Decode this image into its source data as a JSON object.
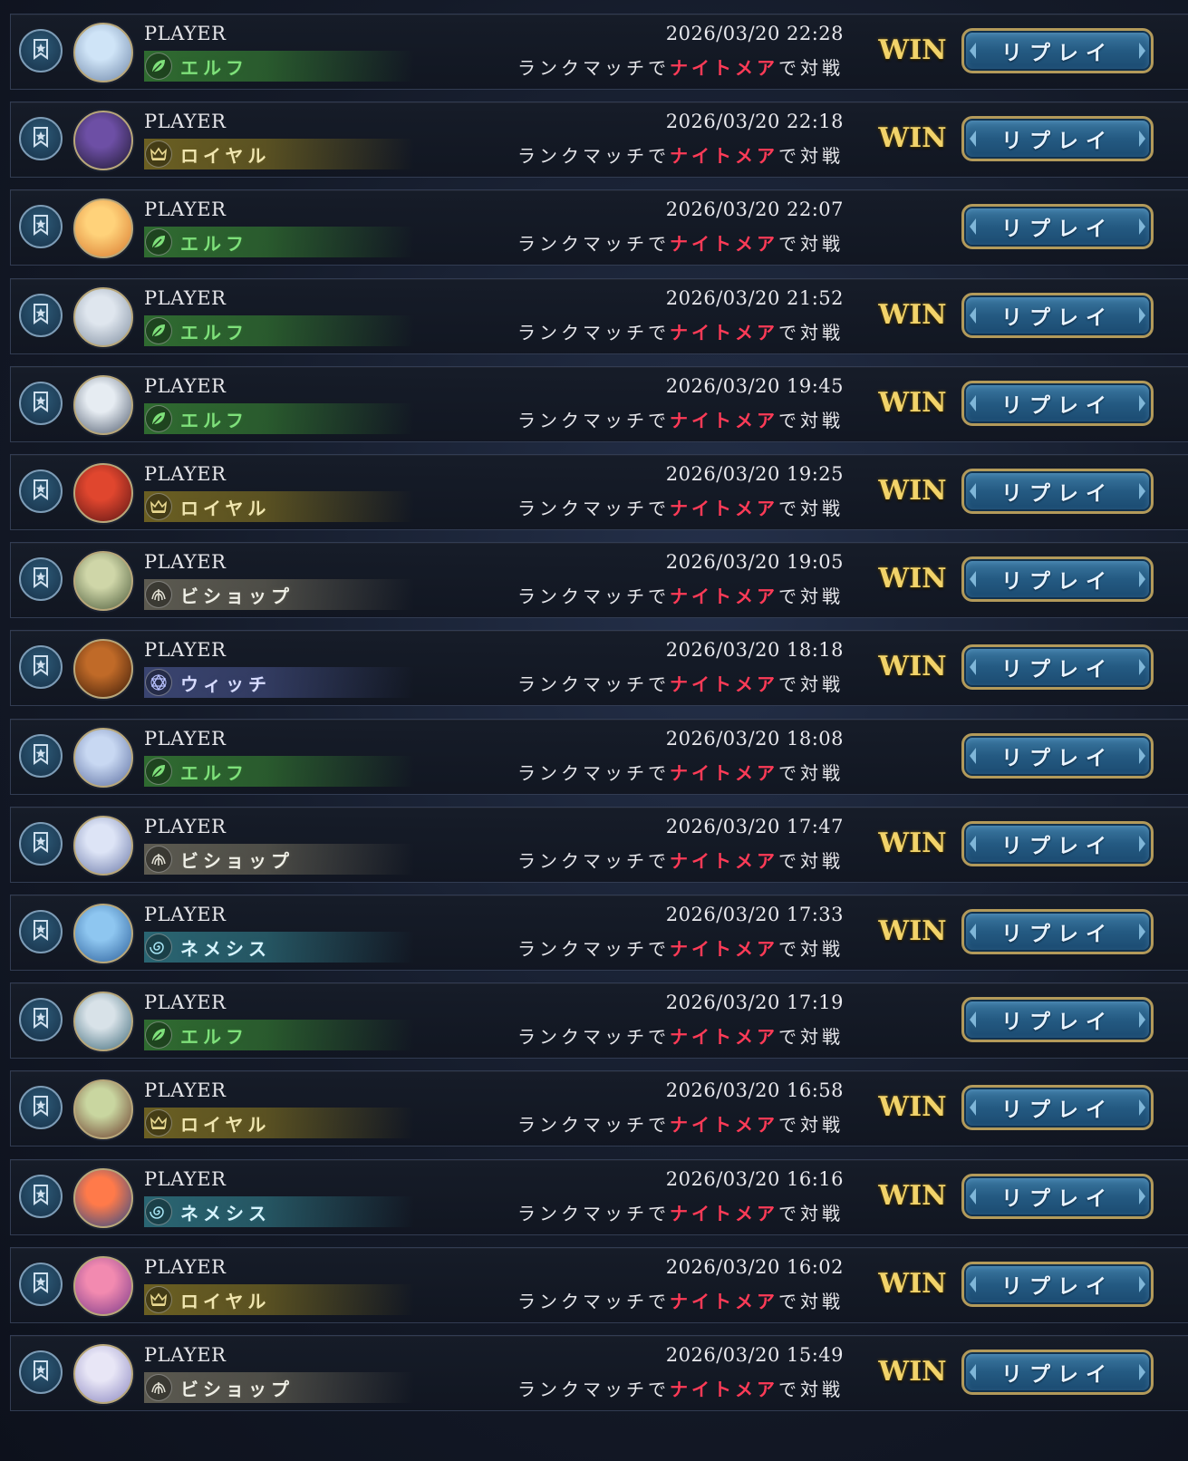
{
  "colors": {
    "elf": "#3d8a3a",
    "royal": "#8a7a2a",
    "bishop": "#7a7566",
    "witch": "#4b5a8a",
    "nemesis": "#3a7f8e",
    "highlight": "#ff3b57",
    "win": "#f2d36a"
  },
  "classes": {
    "elf": {
      "label": "エルフ",
      "icon": "leaf-icon",
      "text_color": "#7ee07a",
      "bar": "#2f6b30"
    },
    "royal": {
      "label": "ロイヤル",
      "icon": "crown-icon",
      "text_color": "#f0e6b0",
      "bar": "#6b5f22"
    },
    "bishop": {
      "label": "ビショップ",
      "icon": "wings-icon",
      "text_color": "#efefe6",
      "bar": "#5c5a50"
    },
    "witch": {
      "label": "ウィッチ",
      "icon": "hexagram-icon",
      "text_color": "#d8dcff",
      "bar": "#3a4470"
    },
    "nemesis": {
      "label": "ネメシス",
      "icon": "spiral-icon",
      "text_color": "#d7f4ff",
      "bar": "#2a6572"
    }
  },
  "replay_label": "リプレイ",
  "description": {
    "before": "ランクマッチで",
    "highlight": "ナイトメア",
    "after": "で対戦"
  },
  "matches": [
    {
      "player": "PLAYER",
      "class": "elf",
      "datetime": "2026/03/20 22:28",
      "result": "WIN",
      "avatar": [
        "#cfe4f7",
        "#6e86a8"
      ]
    },
    {
      "player": "PLAYER",
      "class": "royal",
      "datetime": "2026/03/20 22:18",
      "result": "WIN",
      "avatar": [
        "#6d4fa5",
        "#1e1830"
      ]
    },
    {
      "player": "PLAYER",
      "class": "elf",
      "datetime": "2026/03/20 22:07",
      "result": "",
      "avatar": [
        "#ffd27a",
        "#d8782e"
      ]
    },
    {
      "player": "PLAYER",
      "class": "elf",
      "datetime": "2026/03/20 21:52",
      "result": "WIN",
      "avatar": [
        "#dfe6ee",
        "#7f8d9f"
      ]
    },
    {
      "player": "PLAYER",
      "class": "elf",
      "datetime": "2026/03/20 19:45",
      "result": "WIN",
      "avatar": [
        "#e6ecf2",
        "#4f5b6e"
      ]
    },
    {
      "player": "PLAYER",
      "class": "royal",
      "datetime": "2026/03/20 19:25",
      "result": "WIN",
      "avatar": [
        "#e0462e",
        "#5a1414"
      ]
    },
    {
      "player": "PLAYER",
      "class": "bishop",
      "datetime": "2026/03/20 19:05",
      "result": "WIN",
      "avatar": [
        "#cfd6a8",
        "#4b5a3a"
      ]
    },
    {
      "player": "PLAYER",
      "class": "witch",
      "datetime": "2026/03/20 18:18",
      "result": "WIN",
      "avatar": [
        "#c06a28",
        "#3a1a08"
      ]
    },
    {
      "player": "PLAYER",
      "class": "elf",
      "datetime": "2026/03/20 18:08",
      "result": "",
      "avatar": [
        "#c8d8f2",
        "#5c6ea0"
      ]
    },
    {
      "player": "PLAYER",
      "class": "bishop",
      "datetime": "2026/03/20 17:47",
      "result": "WIN",
      "avatar": [
        "#dde4f6",
        "#6a78a8"
      ]
    },
    {
      "player": "PLAYER",
      "class": "nemesis",
      "datetime": "2026/03/20 17:33",
      "result": "WIN",
      "avatar": [
        "#8ec6f0",
        "#2a5e9a"
      ]
    },
    {
      "player": "PLAYER",
      "class": "elf",
      "datetime": "2026/03/20 17:19",
      "result": "",
      "avatar": [
        "#d8e2e8",
        "#3e6a7a"
      ]
    },
    {
      "player": "PLAYER",
      "class": "royal",
      "datetime": "2026/03/20 16:58",
      "result": "WIN",
      "avatar": [
        "#c9d6a0",
        "#6a3a2a"
      ]
    },
    {
      "player": "PLAYER",
      "class": "nemesis",
      "datetime": "2026/03/20 16:16",
      "result": "WIN",
      "avatar": [
        "#ff7a4a",
        "#2a4a8a"
      ]
    },
    {
      "player": "PLAYER",
      "class": "royal",
      "datetime": "2026/03/20 16:02",
      "result": "WIN",
      "avatar": [
        "#f28ab0",
        "#7a3a8a"
      ]
    },
    {
      "player": "PLAYER",
      "class": "bishop",
      "datetime": "2026/03/20 15:49",
      "result": "WIN",
      "avatar": [
        "#e8e6f6",
        "#8a86c0"
      ]
    }
  ]
}
